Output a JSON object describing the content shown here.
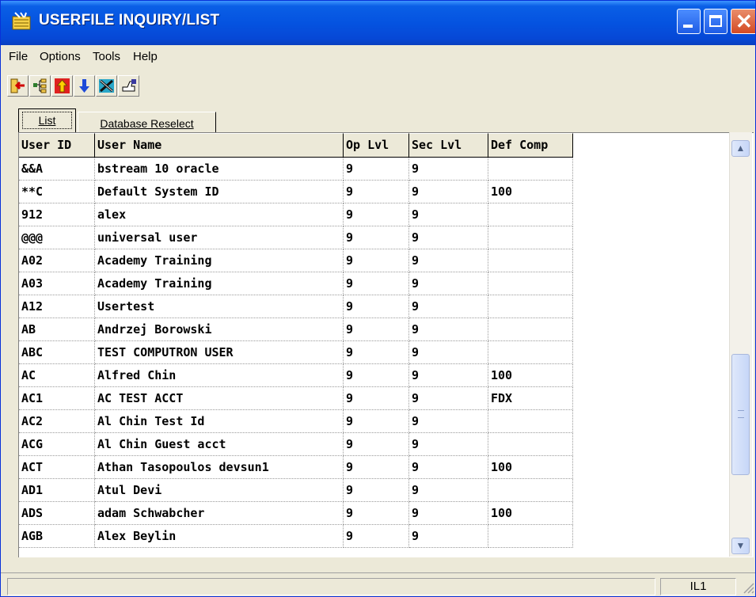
{
  "window": {
    "title": "USERFILE INQUIRY/LIST"
  },
  "menu": [
    "File",
    "Options",
    "Tools",
    "Help"
  ],
  "toolbar": {
    "icons": [
      "exit-icon",
      "tree-icon",
      "page-up-icon",
      "page-down-icon",
      "tools-icon",
      "help-pointer-icon"
    ]
  },
  "tabs": [
    {
      "label": "List",
      "active": true
    },
    {
      "label": "Database Reselect",
      "active": false
    }
  ],
  "table": {
    "columns": [
      "User ID",
      "User Name",
      "Op Lvl",
      "Sec Lvl",
      "Def Comp"
    ],
    "rows": [
      [
        "&&A",
        "bstream 10 oracle",
        "9",
        "9",
        ""
      ],
      [
        "**C",
        "Default System ID",
        "9",
        "9",
        "100"
      ],
      [
        "912",
        "alex",
        "9",
        "9",
        ""
      ],
      [
        "@@@",
        "universal user",
        "9",
        "9",
        ""
      ],
      [
        "A02",
        "Academy Training",
        "9",
        "9",
        ""
      ],
      [
        "A03",
        "Academy Training",
        "9",
        "9",
        ""
      ],
      [
        "A12",
        "Usertest",
        "9",
        "9",
        ""
      ],
      [
        "AB",
        "Andrzej Borowski",
        "9",
        "9",
        ""
      ],
      [
        "ABC",
        "TEST COMPUTRON USER",
        "9",
        "9",
        ""
      ],
      [
        "AC",
        "Alfred Chin",
        "9",
        "9",
        "100"
      ],
      [
        "AC1",
        "AC TEST ACCT",
        "9",
        "9",
        "FDX"
      ],
      [
        "AC2",
        "Al Chin Test Id",
        "9",
        "9",
        ""
      ],
      [
        "ACG",
        "Al Chin Guest acct",
        "9",
        "9",
        ""
      ],
      [
        "ACT",
        "Athan Tasopoulos devsun1",
        "9",
        "9",
        "100"
      ],
      [
        "AD1",
        "Atul Devi",
        "9",
        "9",
        ""
      ],
      [
        "ADS",
        "adam Schwabcher",
        "9",
        "9",
        "100"
      ],
      [
        "AGB",
        "Alex Beylin",
        "9",
        "9",
        ""
      ]
    ]
  },
  "status": {
    "field": "IL1"
  },
  "colors": {
    "titlebar": "#0553e0",
    "face": "#ece9d8",
    "close": "#d44a23"
  }
}
